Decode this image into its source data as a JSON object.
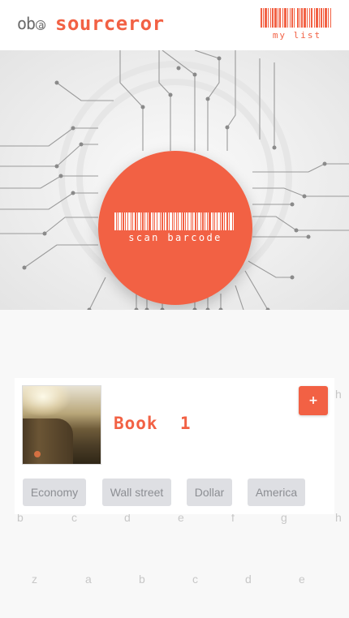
{
  "header": {
    "logo_mark": "ob",
    "brand": "sourceror",
    "my_list_label": "my list"
  },
  "hero": {
    "scan_label": "scan barcode"
  },
  "ghost_row_1": [
    "h"
  ],
  "ghost_row_2": [
    "b",
    "c",
    "d",
    "e",
    "f",
    "g",
    "h"
  ],
  "ghost_row_3": [
    "z",
    "a",
    "b",
    "c",
    "d",
    "e"
  ],
  "book": {
    "title": "Book  1",
    "add_label": "+",
    "tags": [
      "Economy",
      "Wall street",
      "Dollar",
      "America"
    ]
  },
  "colors": {
    "accent": "#f26144",
    "tag_bg": "#dedfe3",
    "tag_text": "#8c8e93"
  }
}
